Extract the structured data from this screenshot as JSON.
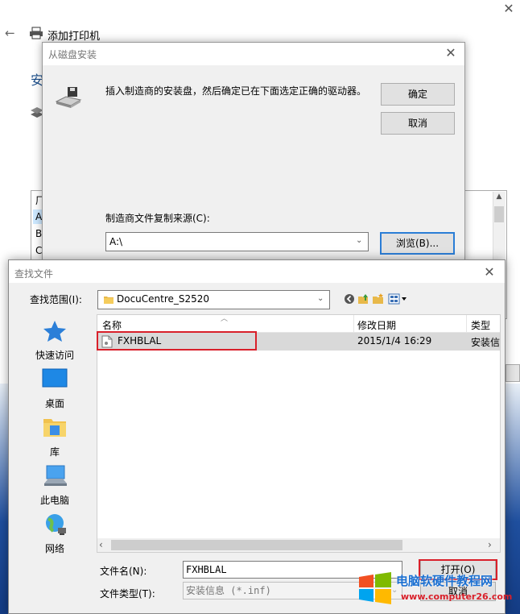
{
  "background_window": {
    "title": "添加打印机",
    "heading": "安",
    "list_items": [
      "厂",
      "A",
      "B",
      "C"
    ]
  },
  "disk_dialog": {
    "title": "从磁盘安装",
    "message": "插入制造商的安装盘，然后确定已在下面选定正确的驱动器。",
    "ok_label": "确定",
    "cancel_label": "取消",
    "source_label": "制造商文件复制来源(C):",
    "source_value": "A:\\",
    "browse_label": "浏览(B)..."
  },
  "find_dialog": {
    "title": "查找文件",
    "look_in_label": "查找范围(I):",
    "look_in_value": "DocuCentre_S2520",
    "places": [
      "快速访问",
      "桌面",
      "库",
      "此电脑",
      "网络"
    ],
    "columns": [
      "名称",
      "修改日期",
      "类型"
    ],
    "files": [
      {
        "name": "FXHBLAL",
        "modified": "2015/1/4 16:29",
        "type": "安装信息"
      }
    ],
    "filename_label": "文件名(N):",
    "filename_value": "FXHBLAL",
    "filetype_label": "文件类型(T):",
    "filetype_value": "安装信息 (*.inf)",
    "open_label": "打开(O)",
    "cancel_label": "取消"
  },
  "watermark": {
    "text": "电脑软硬件教程网",
    "url": "www.computer26.com"
  },
  "colors": {
    "highlight_red": "#d9202a",
    "focus_blue": "#2a7dd6",
    "row_selected": "#d9d9d9"
  }
}
